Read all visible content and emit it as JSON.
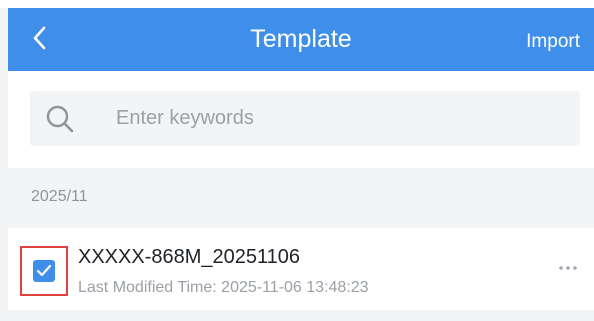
{
  "header": {
    "title": "Template",
    "import_label": "Import",
    "background": "#3f8ee9"
  },
  "search": {
    "placeholder": "Enter keywords",
    "value": ""
  },
  "groups": [
    {
      "label": "2025/11",
      "items": [
        {
          "title": "XXXXX-868M_20251106",
          "meta": "Last Modified Time: 2025-11-06 13:48:23",
          "checked": true,
          "icon": "more-icon"
        }
      ]
    }
  ],
  "colors": {
    "accent": "#3f8ee9",
    "highlight_border": "#e0443e"
  }
}
